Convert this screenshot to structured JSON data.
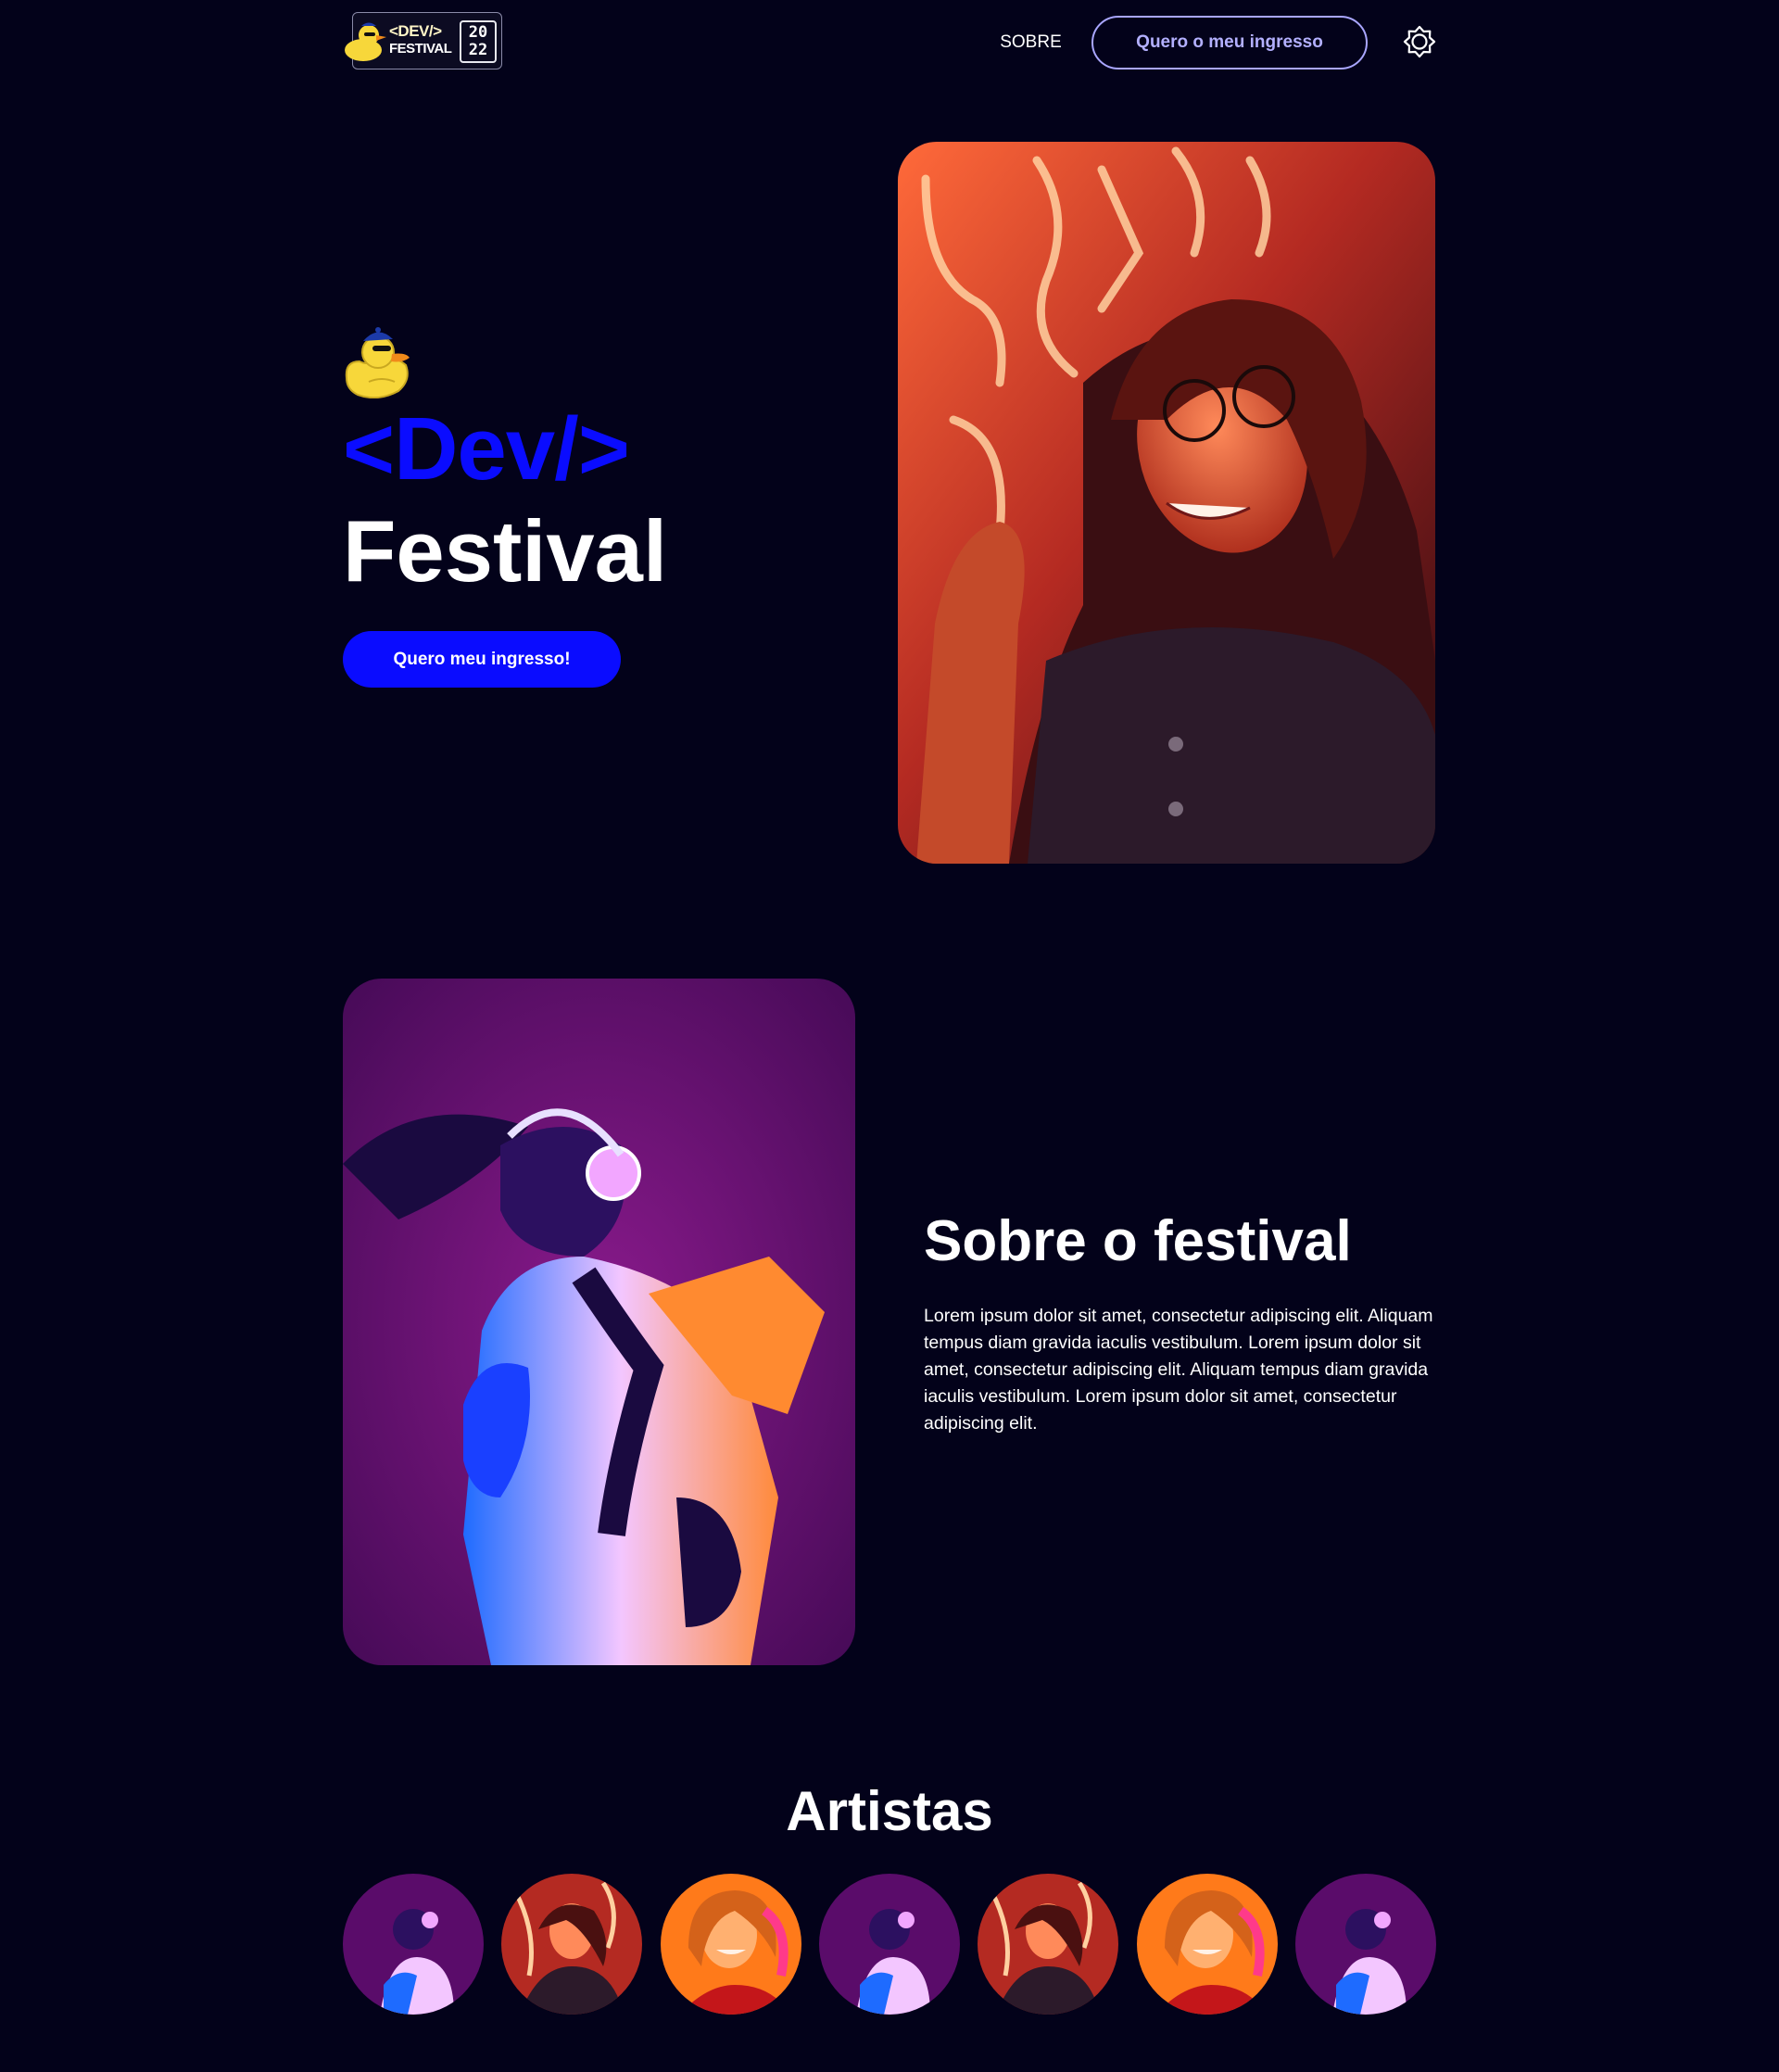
{
  "header": {
    "logo": {
      "word1": "<DEV/>",
      "word2": "FESTIVAL",
      "year_top": "20",
      "year_bottom": "22"
    },
    "nav_about": "SOBRE",
    "nav_cta": "Quero o meu ingresso",
    "theme_icon": "sun-icon"
  },
  "hero": {
    "title_line1": "<Dev/>",
    "title_line2": "Festival",
    "cta": "Quero meu ingresso!",
    "mascot_icon": "duck-icon"
  },
  "about": {
    "title": "Sobre o festival",
    "text": "Lorem ipsum dolor sit amet, consectetur adipiscing elit. Aliquam tempus diam gravida iaculis vestibulum. Lorem ipsum dolor sit amet, consectetur adipiscing elit. Aliquam tempus diam gravida iaculis vestibulum. Lorem ipsum dolor sit amet, consectetur adipiscing elit."
  },
  "artists": {
    "title": "Artistas",
    "items": [
      "purple",
      "red",
      "orange",
      "purple",
      "red",
      "orange",
      "purple"
    ]
  },
  "colors": {
    "background": "#03021a",
    "accent_blue": "#0a0cff",
    "cta_outline": "#a9a6ff",
    "duck_yellow": "#f7d73a"
  }
}
